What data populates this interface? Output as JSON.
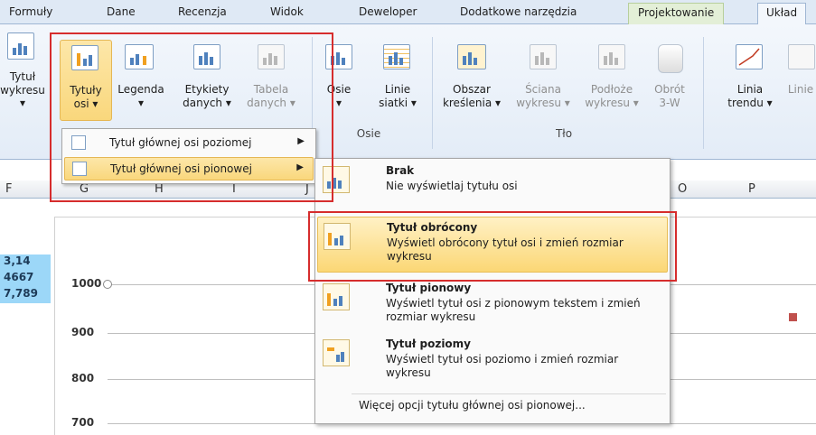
{
  "tabs": [
    "Formuły",
    "Dane",
    "Recenzja",
    "Widok",
    "Deweloper",
    "Dodatkowe narzędzia",
    "Projektowanie",
    "Układ"
  ],
  "ribbon": {
    "buttons": [
      {
        "l1": "Tytuł",
        "l2": "wykresu ▾"
      },
      {
        "l1": "Tytuły",
        "l2": "osi ▾"
      },
      {
        "l1": "Legenda",
        "l2": "▾"
      },
      {
        "l1": "Etykiety",
        "l2": "danych ▾"
      },
      {
        "l1": "Tabela",
        "l2": "danych ▾"
      },
      {
        "l1": "Osie",
        "l2": "▾"
      },
      {
        "l1": "Linie",
        "l2": "siatki ▾"
      },
      {
        "l1": "Obszar",
        "l2": "kreślenia ▾"
      },
      {
        "l1": "Ściana",
        "l2": "wykresu ▾"
      },
      {
        "l1": "Podłoże",
        "l2": "wykresu ▾"
      },
      {
        "l1": "Obrót",
        "l2": "3-W"
      },
      {
        "l1": "Linia",
        "l2": "trendu ▾"
      },
      {
        "l1": "Linie",
        "l2": ""
      }
    ],
    "groups": {
      "osie": "Osie",
      "tlo": "Tło"
    }
  },
  "menu1": {
    "items": [
      "Tytuł głównej osi poziomej",
      "Tytuł głównej osi pionowej"
    ]
  },
  "menu2": {
    "options": [
      {
        "title": "Brak",
        "desc": "Nie wyświetlaj tytułu osi"
      },
      {
        "title": "Tytuł obrócony",
        "desc": "Wyświetl obrócony tytuł osi i zmień rozmiar wykresu"
      },
      {
        "title": "Tytuł pionowy",
        "desc": "Wyświetl tytuł osi z pionowym tekstem i zmień rozmiar wykresu"
      },
      {
        "title": "Tytuł poziomy",
        "desc": "Wyświetl tytuł osi poziomo i zmień rozmiar wykresu"
      }
    ],
    "more": "Więcej opcji tytułu głównej osi pionowej..."
  },
  "sheet": {
    "columns": [
      "F",
      "G",
      "H",
      "I",
      "J",
      "O",
      "P"
    ],
    "cells": [
      "3,14",
      "4667",
      "7,789"
    ],
    "yticks": [
      "1000",
      "900",
      "800",
      "700"
    ]
  }
}
